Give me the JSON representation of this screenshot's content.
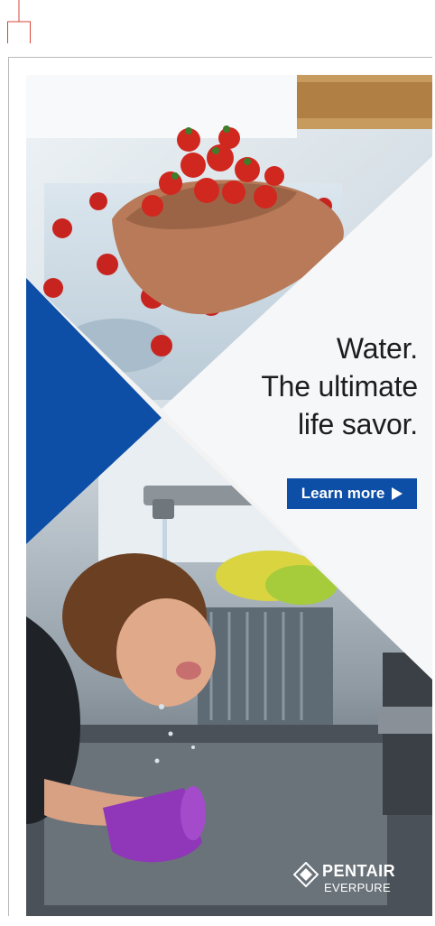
{
  "ad": {
    "headline": {
      "line1": "Water.",
      "line2": "The ultimate",
      "line3": "life savor."
    },
    "cta": {
      "label": "Learn more"
    },
    "brand": {
      "name": "PENTAIR",
      "sub": "EVERPURE"
    },
    "colors": {
      "accent_blue": "#0d4ea6",
      "headline_text": "#1d1d1d",
      "background": "#f3f3f3"
    }
  }
}
